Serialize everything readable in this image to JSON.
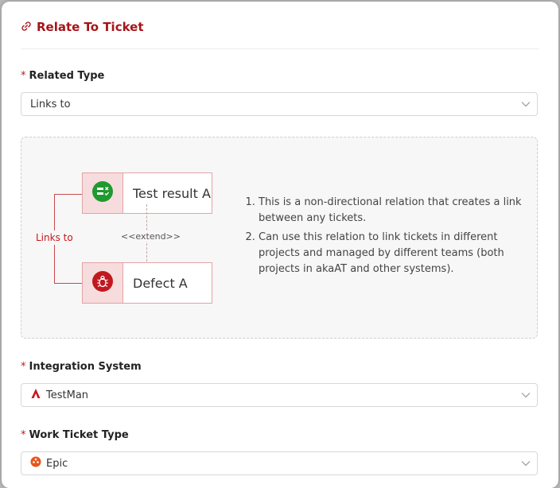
{
  "dialog": {
    "title": "Relate To Ticket"
  },
  "related_type": {
    "label": "Related Type",
    "required_mark": "*",
    "value": "Links to"
  },
  "diagram": {
    "ticket_top": "Test result A",
    "ticket_bottom": "Defect A",
    "relation_label": "Links to",
    "extend_label": "<<extend>>",
    "notes": [
      "This is a non-directional relation that creates a link between any tickets.",
      "Can use this relation to link tickets in different projects and managed by different teams (both projects in akaAT and other systems)."
    ]
  },
  "integration_system": {
    "label": "Integration System",
    "required_mark": "*",
    "value": "TestMan"
  },
  "work_ticket_type": {
    "label": "Work Ticket Type",
    "required_mark": "*",
    "value": "Epic"
  },
  "colors": {
    "accent": "#a5141a",
    "required": "#c8161d",
    "epic": "#e8541c"
  }
}
